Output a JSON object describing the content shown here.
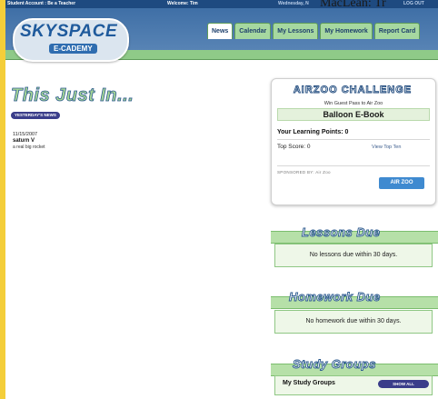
{
  "topbar": {
    "account": "Student Account : Be a Teacher",
    "welcome": "Welcome: Tim",
    "date": "Wednesday, N",
    "logout": "LOG OUT",
    "overlay": "MacLean: Tr"
  },
  "logo": {
    "main": "SKYSPACE",
    "sub": "E-CADEMY"
  },
  "tabs": [
    "News",
    "Calendar",
    "My Lessons",
    "My Homework",
    "Report Card"
  ],
  "news": {
    "title": "This Just In...",
    "yesterday_button": "YESTERDAY'S NEWS",
    "items": [
      {
        "date": "11/15/2007",
        "headline": "saturn V",
        "subtitle": "a real big rocket"
      }
    ]
  },
  "airzoo": {
    "title": "AIRZOO CHALLENGE",
    "win_text": "Win Guest Pass to Air Zoo",
    "book": "Balloon E-Book",
    "points_label": "Your Learning Points: 0",
    "top_score": "Top Score: 0",
    "top_ten_link": "View Top Ten",
    "sponsor": "SPONSORED BY: Air Zoo",
    "button": "AIR ZOO"
  },
  "lessons": {
    "title": "Lessons Due",
    "message": "No lessons due within 30 days."
  },
  "homework": {
    "title": "Homework Due",
    "message": "No homework due within 30 days."
  },
  "study_groups": {
    "title": "Study Groups",
    "label": "My Study Groups",
    "button": "SHOW ALL"
  }
}
